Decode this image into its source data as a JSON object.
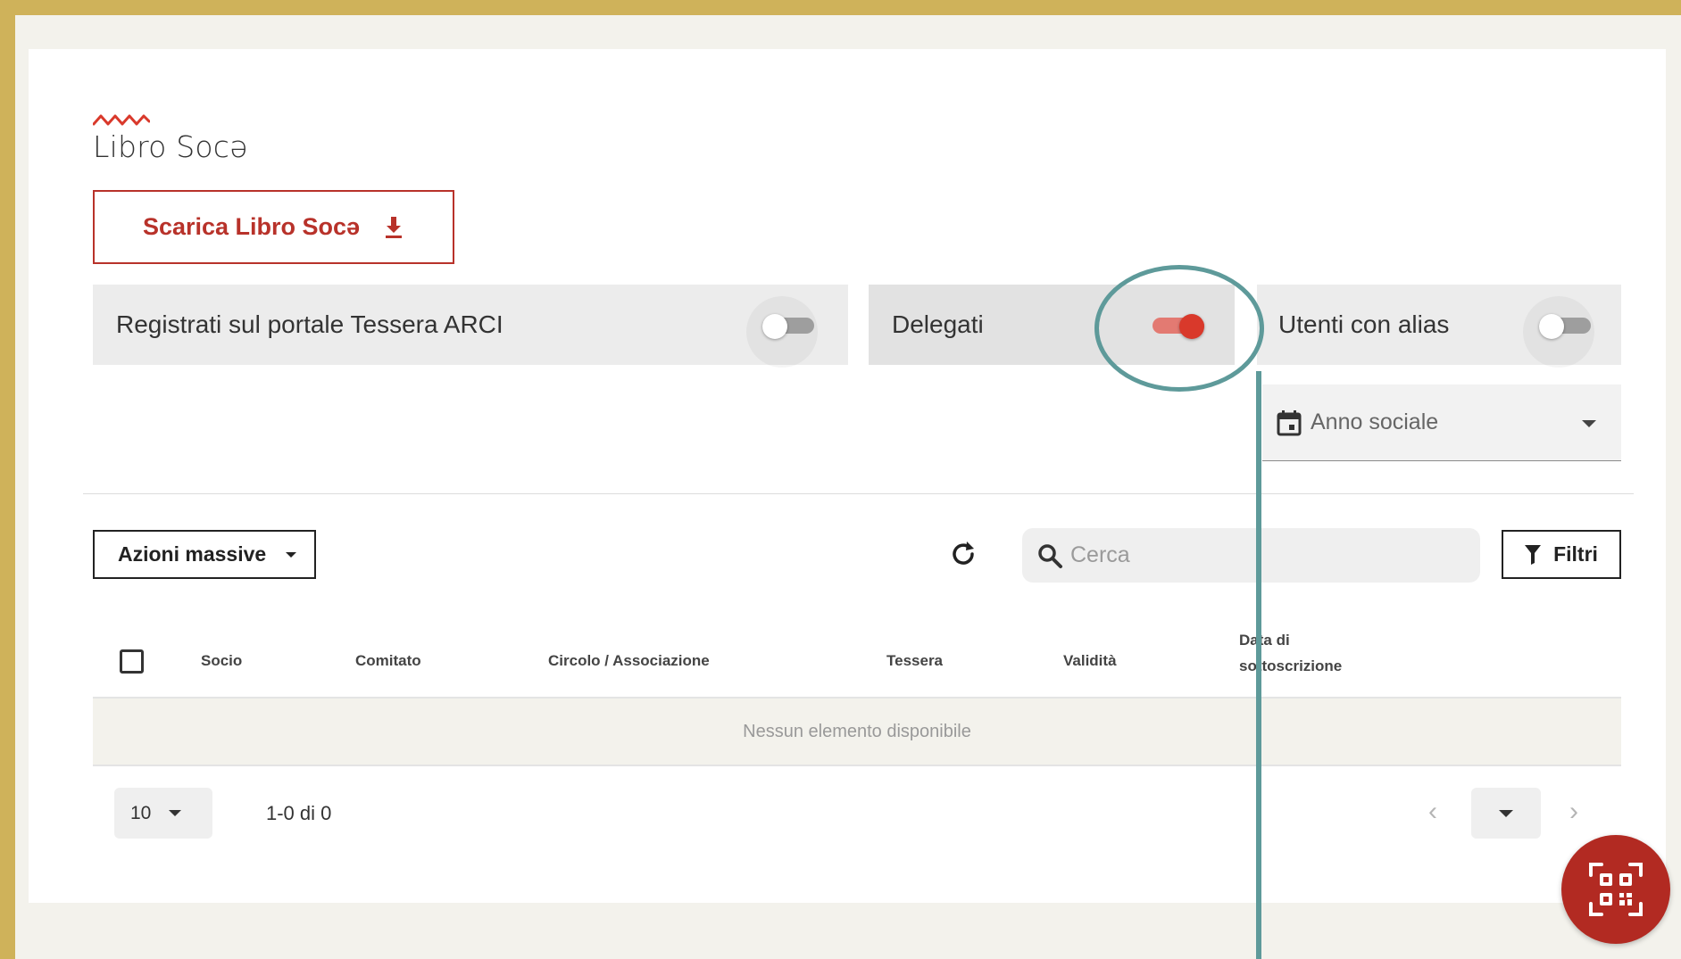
{
  "header": {
    "title": "Libro Socə",
    "download_label": "Scarica Libro Socə"
  },
  "toggles": [
    {
      "label": "Registrati sul portale Tessera ARCI",
      "checked": false
    },
    {
      "label": "Delegati",
      "checked": true
    },
    {
      "label": "Utenti con alias",
      "checked": false
    }
  ],
  "filters": {
    "year_placeholder": "Anno sociale"
  },
  "toolbar": {
    "bulk_actions_label": "Azioni massive",
    "search_placeholder": "Cerca",
    "filters_label": "Filtri"
  },
  "table": {
    "headers": {
      "socio": "Socio",
      "comitato": "Comitato",
      "circolo": "Circolo / Associazione",
      "tessera": "Tessera",
      "validita": "Validità",
      "data": "Data di sottoscrizione"
    },
    "empty_message": "Nessun elemento disponibile"
  },
  "pagination": {
    "per_page": "10",
    "range": "1-0 di 0"
  },
  "colors": {
    "accent": "#b8322a",
    "frame": "#cfb25a",
    "annotation": "#5e9a9a"
  }
}
